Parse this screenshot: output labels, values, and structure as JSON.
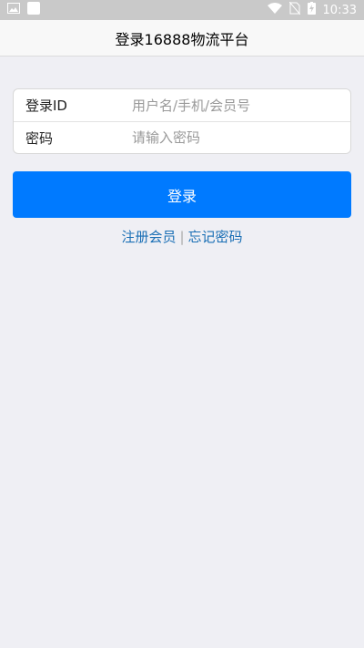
{
  "status_bar": {
    "time": "10:33",
    "icons": [
      "image-icon",
      "square-icon",
      "wifi-icon",
      "no-sim-icon",
      "battery-charging-icon"
    ]
  },
  "header": {
    "title": "登录16888物流平台"
  },
  "form": {
    "login_id": {
      "label": "登录ID",
      "placeholder": "用户名/手机/会员号"
    },
    "password": {
      "label": "密码",
      "placeholder": "请输入密码"
    }
  },
  "login_button": "登录",
  "links": {
    "register": "注册会员",
    "separator": "|",
    "forgot": "忘记密码"
  },
  "colors": {
    "accent": "#007aff",
    "link": "#1a6fb5",
    "background": "#efeff4"
  }
}
